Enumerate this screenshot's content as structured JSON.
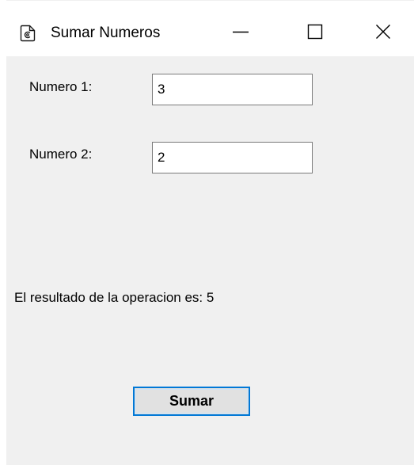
{
  "window": {
    "title": "Sumar Numeros",
    "icon": "app-document-icon",
    "controls": {
      "minimize_icon": "minimize-icon",
      "maximize_icon": "maximize-icon",
      "close_icon": "close-icon"
    }
  },
  "form": {
    "numero1": {
      "label": "Numero 1:",
      "value": "3"
    },
    "numero2": {
      "label": "Numero 2:",
      "value": "2"
    },
    "result_text": "El resultado de la operacion es: 5",
    "submit_label": "Sumar"
  },
  "colors": {
    "window_background": "#f0f0f0",
    "titlebar_background": "#ffffff",
    "button_focus_border": "#0078d7",
    "button_face": "#e1e1e1",
    "input_border": "#7a7a7a"
  }
}
